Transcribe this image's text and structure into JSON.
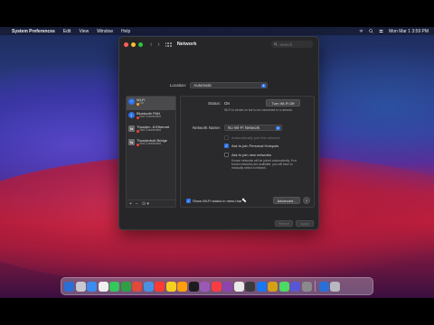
{
  "menubar": {
    "app_name": "System Preferences",
    "menus": [
      "Edit",
      "View",
      "Window",
      "Help"
    ],
    "clock": "Mon Mar 1  3:59 PM"
  },
  "window": {
    "title": "Network",
    "search_placeholder": "Search"
  },
  "location": {
    "label": "Location:",
    "value": "Automatic"
  },
  "services": [
    {
      "name": "Wi-Fi",
      "status": "On",
      "status_color": "orange",
      "selected": true,
      "icon": "wifi-icon"
    },
    {
      "name": "Bluetooth PAN",
      "status": "Not Connected",
      "status_color": "red",
      "selected": false,
      "icon": "bluetooth-icon"
    },
    {
      "name": "Thunder...lt Ethernet",
      "status": "Not Connected",
      "status_color": "red",
      "selected": false,
      "icon": "ethernet-icon"
    },
    {
      "name": "Thunderbolt Bridge",
      "status": "Not Connected",
      "status_color": "red",
      "selected": false,
      "icon": "bridge-icon"
    }
  ],
  "sidebar_footer": {
    "add": "+",
    "remove": "−",
    "actions": "⊙ ▾"
  },
  "detail": {
    "status_label": "Status:",
    "status_value": "On",
    "turn_off_label": "Turn Wi-Fi Off",
    "status_desc": "Wi-Fi is turned on but is not connected to a network.",
    "network_name_label": "Network Name:",
    "network_name_value": "No Wi-Fi Network",
    "auto_join_label": "Automatically join this network",
    "ask_hotspots_label": "Ask to join Personal Hotspots",
    "ask_new_label": "Ask to join new networks",
    "ask_new_desc": "Known networks will be joined automatically. If no known networks are available, you will have to manually select a network.",
    "show_status_label": "Show Wi-Fi status in menu bar",
    "advanced_label": "Advanced...",
    "help_label": "?"
  },
  "bottom_buttons": {
    "revert": "Revert",
    "apply": "Apply"
  },
  "dock": {
    "colors": [
      "#2a6fd6",
      "#c8c8d0",
      "#3a8cf0",
      "#f0f0f0",
      "#34c759",
      "#2ea043",
      "#e04a3a",
      "#4a90e2",
      "#ff3b30",
      "#f5d020",
      "#ff9f0a",
      "#1c1c1e",
      "#9b59b6",
      "#fc3c44",
      "#8e44ad",
      "#e8e8e8",
      "#3a3a3c",
      "#1877f2",
      "#d4a017",
      "#4cd964",
      "#5856d6",
      "#8a8a8e"
    ],
    "trailing_colors": [
      "#2a6fd6",
      "#b8b8c0"
    ]
  }
}
